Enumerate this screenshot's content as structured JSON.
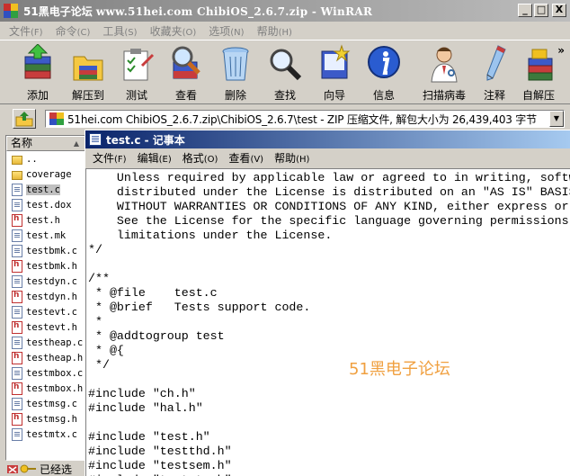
{
  "winrar": {
    "title_prefix": "51黑电子论坛 ",
    "title_main": "www.51hei.com ChibiOS_2.6.7.zip - WinRAR",
    "window_buttons": [
      "_",
      "□",
      "X"
    ],
    "menu": [
      {
        "label": "文件",
        "hotkey": "(F)"
      },
      {
        "label": "命令",
        "hotkey": "(C)"
      },
      {
        "label": "工具",
        "hotkey": "(S)"
      },
      {
        "label": "收藏夹",
        "hotkey": "(O)"
      },
      {
        "label": "选项",
        "hotkey": "(N)"
      },
      {
        "label": "帮助",
        "hotkey": "(H)"
      }
    ],
    "toolbar": [
      {
        "label": "添加",
        "icon": "add-stack-icon"
      },
      {
        "label": "解压到",
        "icon": "extract-folder-icon"
      },
      {
        "label": "测试",
        "icon": "test-clipboard-icon"
      },
      {
        "label": "查看",
        "icon": "view-magnifier-icon"
      },
      {
        "label": "删除",
        "icon": "trash-can-icon"
      },
      {
        "label": "查找",
        "icon": "find-magnifier-icon"
      },
      {
        "label": "向导",
        "icon": "wizard-icon"
      },
      {
        "label": "信息",
        "icon": "info-icon"
      },
      {
        "label": "扫描病毒",
        "icon": "virus-scan-doctor-icon"
      },
      {
        "label": "注释",
        "icon": "comment-pen-icon"
      },
      {
        "label": "自解压",
        "icon": "sfx-box-icon"
      }
    ],
    "toolbar_more": "»",
    "address": "51hei.com ChibiOS_2.6.7.zip\\ChibiOS_2.6.7\\test - ZIP 压缩文件, 解包大小为 26,439,403 字节",
    "column_name": "名称",
    "files": [
      {
        "name": "..",
        "type": "folder"
      },
      {
        "name": "coverage",
        "type": "folder"
      },
      {
        "name": "test.c",
        "type": "txt",
        "selected": true
      },
      {
        "name": "test.dox",
        "type": "txt"
      },
      {
        "name": "test.h",
        "type": "hfile"
      },
      {
        "name": "test.mk",
        "type": "txt"
      },
      {
        "name": "testbmk.c",
        "type": "txt"
      },
      {
        "name": "testbmk.h",
        "type": "hfile"
      },
      {
        "name": "testdyn.c",
        "type": "txt"
      },
      {
        "name": "testdyn.h",
        "type": "hfile"
      },
      {
        "name": "testevt.c",
        "type": "txt"
      },
      {
        "name": "testevt.h",
        "type": "hfile"
      },
      {
        "name": "testheap.c",
        "type": "txt"
      },
      {
        "name": "testheap.h",
        "type": "hfile"
      },
      {
        "name": "testmbox.c",
        "type": "txt"
      },
      {
        "name": "testmbox.h",
        "type": "hfile"
      },
      {
        "name": "testmsg.c",
        "type": "txt"
      },
      {
        "name": "testmsg.h",
        "type": "hfile"
      },
      {
        "name": "testmtx.c",
        "type": "txt"
      }
    ],
    "status_text": "已经选"
  },
  "notepad": {
    "title": "test.c - 记事本",
    "menu": [
      {
        "label": "文件",
        "hotkey": "(F)"
      },
      {
        "label": "编辑",
        "hotkey": "(E)"
      },
      {
        "label": "格式",
        "hotkey": "(O)"
      },
      {
        "label": "查看",
        "hotkey": "(V)"
      },
      {
        "label": "帮助",
        "hotkey": "(H)"
      }
    ],
    "content": "    Unless required by applicable law or agreed to in writing, software\n    distributed under the License is distributed on an \"AS IS\" BASIS,\n    WITHOUT WARRANTIES OR CONDITIONS OF ANY KIND, either express or implied.\n    See the License for the specific language governing permissions and\n    limitations under the License.\n*/\n\n/**\n * @file    test.c\n * @brief   Tests support code.\n *\n * @addtogroup test\n * @{\n */\n\n#include \"ch.h\"\n#include \"hal.h\"\n\n#include \"test.h\"\n#include \"testthd.h\"\n#include \"testsem.h\"\n#include \"testmtx.h\""
  },
  "watermark": "51黑电子论坛"
}
